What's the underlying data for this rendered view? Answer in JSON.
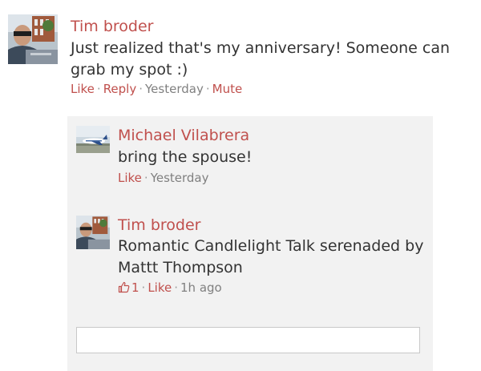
{
  "post": {
    "author": "Tim broder",
    "text": "Just realized that's my anniversary! Someone can grab my spot :)",
    "like": "Like",
    "reply": "Reply",
    "time": "Yesterday",
    "mute": "Mute",
    "avatar_icon": "person-photo"
  },
  "replies": [
    {
      "author": "Michael Vilabrera",
      "text": "bring the spouse!",
      "like": "Like",
      "time": "Yesterday",
      "avatar_icon": "airplane-photo"
    },
    {
      "author": "Tim broder",
      "text": "Romantic Candlelight Talk serenaded by Mattt Thompson",
      "like_count": "1",
      "like": "Like",
      "time": "1h ago",
      "avatar_icon": "person-photo"
    }
  ],
  "reply_input": {
    "placeholder": ""
  },
  "colors": {
    "accent": "#c0504d",
    "text": "#333333",
    "muted": "#808080",
    "panel": "#f2f2f2"
  }
}
